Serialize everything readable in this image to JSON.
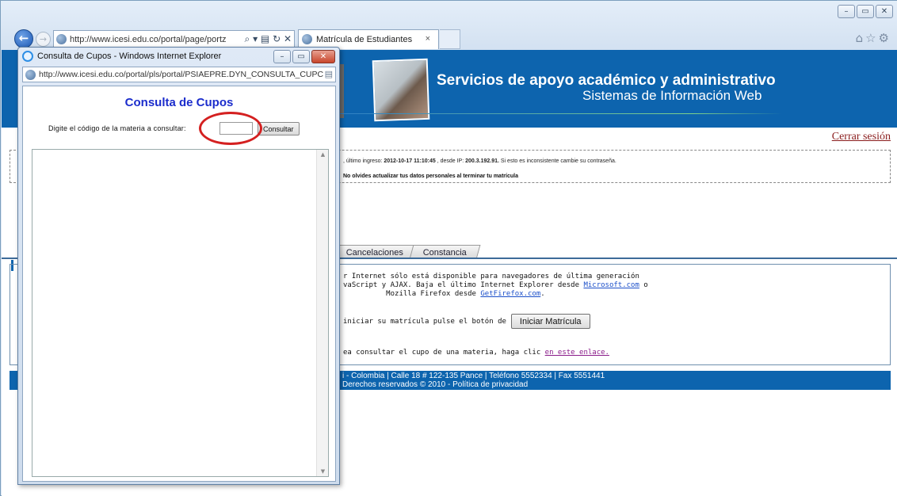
{
  "main_window": {
    "address_url": "http://www.icesi.edu.co/portal/page/portz",
    "address_tools": "⌕ ▾ ▤ ↻ ✕",
    "back_glyph": "←",
    "forward_glyph": "→",
    "tab_title": "Matrícula de Estudiantes",
    "tab_close": "×",
    "fav_icons": "⌂☆⚙",
    "minimize": "–",
    "restore": "▭",
    "close": "✕"
  },
  "banner": {
    "title": "Servicios de apoyo académico y administrativo",
    "subtitle": "Sistemas de Información Web"
  },
  "logout_label": "Cerrar sesión",
  "login_info": {
    "prefix": ", último ingreso: ",
    "date": "2012-10-17 11:10:45",
    "mid": " , desde IP: ",
    "ip": "200.3.192.91.",
    "suffix": " Si esto es inconsistente cambie su contraseña."
  },
  "update_message": "No olvides actualizar tus datos personales al terminar tu matrícula",
  "tabs": [
    "Cancelaciones",
    "Constancia"
  ],
  "notice": {
    "line1": "r Internet sólo está disponible para navegadores de última generación",
    "line2_pre": "vaScript y AJAX. Baja el último Internet Explorer desde ",
    "microsoft_link": "Microsoft.com",
    "line2_post": " o",
    "line3_pre": "          Mozilla Firefox desde ",
    "firefox_link": "GetFirefox.com",
    "line3_post": "."
  },
  "start_prompt": "iniciar su matrícula pulse el botón de",
  "start_button": "Iniciar Matrícula",
  "query_prompt": "ea consultar el cupo de una materia, haga clic ",
  "query_link": "en este enlace.",
  "footer": {
    "line1": "i - Colombia | Calle 18 # 122-135 Pance | Teléfono 5552334 | Fax 5551441",
    "line2": "Derechos reservados © 2010 - Política de privacidad"
  },
  "popup": {
    "window_title": "Consulta de Cupos - Windows Internet Explorer",
    "address_url": "http://www.icesi.edu.co/portal/pls/portal/PSIAEPRE.DYN_CONSULTA_CUPC",
    "lock_glyph": "▤",
    "heading": "Consulta de Cupos",
    "prompt": "Digite el código de la materia a consultar:",
    "input_value": "",
    "button_label": "Consultar",
    "scroll_up": "▲",
    "scroll_down": "▼"
  },
  "colors": {
    "banner_blue": "#0d64ae",
    "heading_blue": "#1b2ccc",
    "highlight_red": "#d42020",
    "logout_red": "#8a1c1c"
  }
}
